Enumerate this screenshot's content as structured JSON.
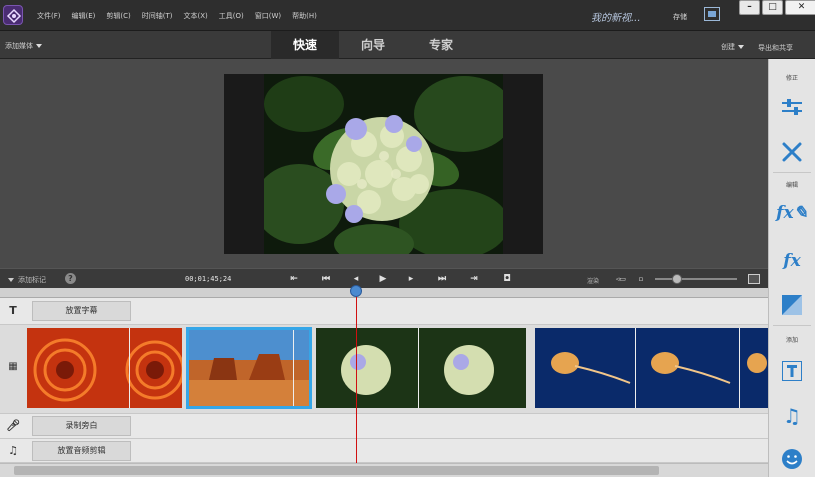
{
  "menu": [
    "文件(F)",
    "编辑(E)",
    "剪辑(C)",
    "时间轴(T)",
    "文本(X)",
    "工具(O)",
    "窗口(W)",
    "帮助(H)"
  ],
  "project_title": "我的新视...",
  "save_label": "存储",
  "window_controls": {
    "minimize": "–",
    "maximize": "□",
    "close": "✕"
  },
  "add_media_label": "添加媒体",
  "modes": [
    "快速",
    "向导",
    "专家"
  ],
  "active_mode": "快速",
  "create_label": "创建",
  "export_label": "导出和共享",
  "right_panel": {
    "section_adjust": "修正",
    "section_edit": "编辑",
    "section_add": "添加"
  },
  "transport": {
    "add_marker_label": "添加标记",
    "timecode": "00;01;45;24",
    "render_label": "渲染"
  },
  "tracks": {
    "title_button": "放置字幕",
    "narration_button": "录制旁白",
    "audio_button": "放置音频剪辑"
  },
  "colors": {
    "accent": "#2d7fc8",
    "playhead": "#d01010",
    "selection": "#35a6e8"
  }
}
